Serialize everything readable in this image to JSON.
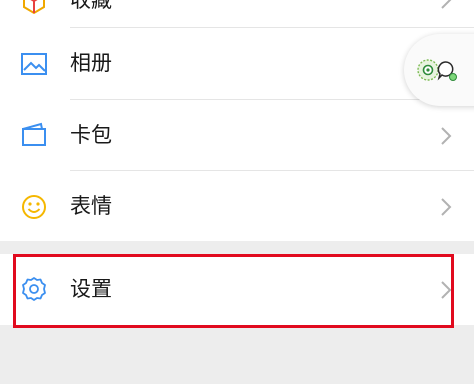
{
  "menu": {
    "items": [
      {
        "label": "收藏",
        "icon": "cube-icon"
      },
      {
        "label": "相册",
        "icon": "image-icon"
      },
      {
        "label": "卡包",
        "icon": "card-wallet-icon"
      },
      {
        "label": "表情",
        "icon": "smiley-icon"
      }
    ],
    "settings": {
      "label": "设置",
      "icon": "gear-icon"
    }
  },
  "floating_window": {
    "icon": "mini-program-float-icon"
  },
  "colors": {
    "accent_blue": "#3b8ff0",
    "smiley_yellow": "#f5b700",
    "highlight_red": "#e10a1e",
    "background": "#ededed"
  }
}
